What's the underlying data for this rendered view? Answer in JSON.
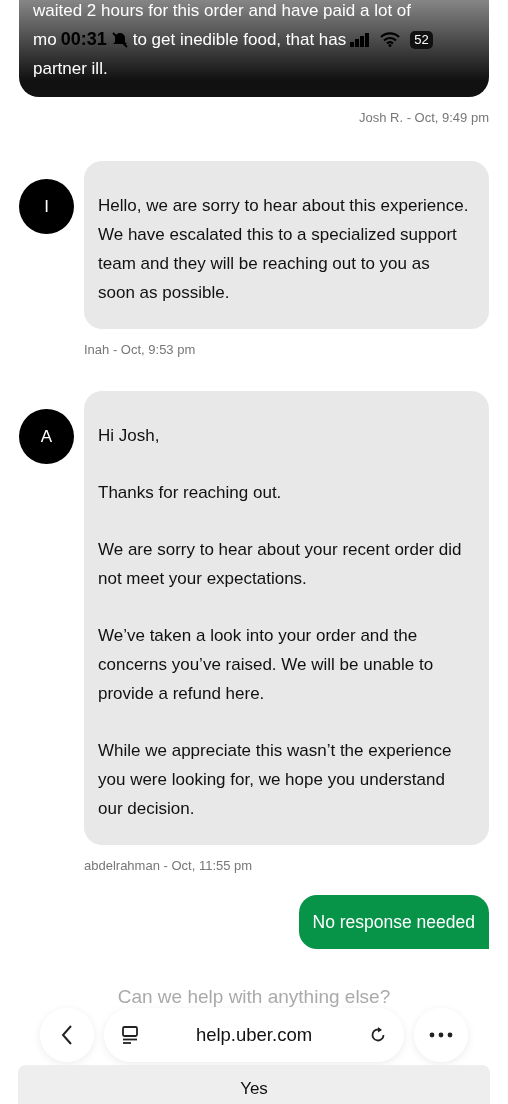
{
  "status_bar": {
    "time": "00:31",
    "battery": "52",
    "silent": true
  },
  "messages": [
    {
      "kind": "user-dark",
      "line_1": "waited 2 hours for this order and have paid a lot of",
      "line_2_fragments": [
        "mo",
        "to get inedible food, that has"
      ],
      "line_3": "partner ill.",
      "meta": "Josh R. - Oct, 9:49 pm"
    },
    {
      "kind": "agent",
      "avatar": "I",
      "paragraphs": [
        "Hello, we are sorry to hear about this experience. We have escalated this to a specialized support team and they will be reaching out to you as soon as possible."
      ],
      "meta": "Inah - Oct, 9:53 pm"
    },
    {
      "kind": "agent",
      "avatar": "A",
      "paragraphs": [
        "Hi Josh,",
        "Thanks for reaching out.",
        "We are sorry to hear about your recent order did not meet your expectations.",
        "We’ve taken a look into your order and the concerns you’ve raised. We will be unable to provide a refund here.",
        "While we appreciate this wasn’t the experience you were looking for, we hope you understand our decision."
      ],
      "meta": "abdelrahman - Oct, 11:55 pm"
    },
    {
      "kind": "user-green",
      "text": "No response needed"
    }
  ],
  "prompt": "Can we help with anything else?",
  "browser_bar": {
    "url": "help.uber.com"
  },
  "answers": [
    "Yes"
  ]
}
